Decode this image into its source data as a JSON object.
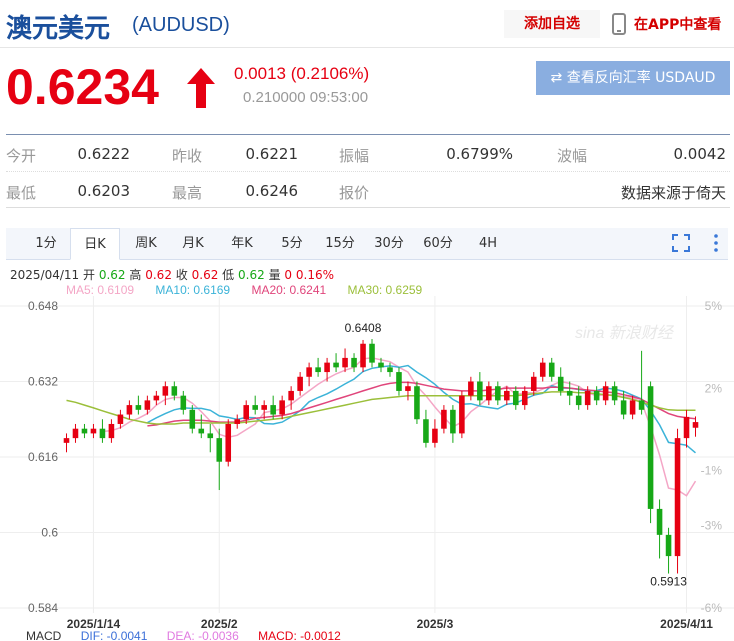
{
  "header": {
    "title": "澳元美元",
    "code": "(AUDUSD)",
    "add_favorite": "添加自选",
    "view_in_app": "在APP中查看"
  },
  "quote": {
    "price": "0.6234",
    "change": "0.0013 (0.2106%)",
    "subinfo": "0.210000 09:53:00",
    "reverse_button": "⇄ 查看反向汇率 USDAUD"
  },
  "stats": [
    [
      {
        "label": "今开",
        "value": "0.6222"
      },
      {
        "label": "昨收",
        "value": "0.6221"
      },
      {
        "label": "振幅",
        "value": "0.6799%"
      },
      {
        "label": "波幅",
        "value": "0.0042"
      }
    ],
    [
      {
        "label": "最低",
        "value": "0.6203"
      },
      {
        "label": "最高",
        "value": "0.6246"
      },
      {
        "label": "报价",
        "value": "数据来源于倚天"
      }
    ]
  ],
  "tabs": [
    "1分",
    "日K",
    "周K",
    "月K",
    "年K",
    "5分",
    "15分",
    "30分",
    "60分",
    "4H"
  ],
  "active_tab": "日K",
  "ohlc": {
    "date": "2025/04/11",
    "open_label": "开",
    "open": "0.62",
    "high_label": "高",
    "high": "0.62",
    "close_label": "收",
    "close": "0.62",
    "low_label": "低",
    "low": "0.62",
    "vol_label": "量",
    "vol": "0",
    "pct": "0.16%"
  },
  "ma_legend": [
    {
      "label": "MA5: 0.6109",
      "color": "#f4a6c6"
    },
    {
      "label": "MA10: 0.6169",
      "color": "#3bb3d8"
    },
    {
      "label": "MA20: 0.6241",
      "color": "#e0457b"
    },
    {
      "label": "MA30: 0.6259",
      "color": "#9bbf3a"
    }
  ],
  "macd": [
    {
      "label": "MACD",
      "color": "#333333"
    },
    {
      "label": "DIF: -0.0041",
      "color": "#3b6fd8"
    },
    {
      "label": "DEA: -0.0036",
      "color": "#e07ae0"
    },
    {
      "label": "MACD: -0.0012",
      "color": "#e60012"
    }
  ],
  "colors": {
    "up": "#e60012",
    "down": "#17a817",
    "title": "#1a4f9c"
  },
  "icons": {
    "arrow": "up-arrow-icon",
    "phone": "phone-icon",
    "fullscreen": "fullscreen-icon",
    "more": "more-vertical-icon"
  },
  "chart_data": {
    "type": "candlestick",
    "ylim": [
      0.584,
      0.648
    ],
    "y_ticks": [
      "0.648",
      "0.632",
      "0.616",
      "0.6",
      "0.584"
    ],
    "y_tick_values": [
      0.648,
      0.632,
      0.616,
      0.6,
      0.584
    ],
    "pct_ticks": [
      "5%",
      "2%",
      "-1%",
      "-3%",
      "-6%"
    ],
    "pct_tick_values": [
      5,
      2,
      -1,
      -3,
      -6
    ],
    "pct_lim": [
      5,
      -6
    ],
    "x_labels": [
      {
        "label": "2025/1/14",
        "index": 3
      },
      {
        "label": "2025/2",
        "index": 17
      },
      {
        "label": "2025/3",
        "index": 41
      },
      {
        "label": "2025/4/11",
        "index": 69
      }
    ],
    "annotations": [
      {
        "label": "0.6408",
        "index": 33,
        "value": 0.6408
      },
      {
        "label": "0.5913",
        "index": 67,
        "value": 0.5913
      }
    ],
    "candles": [
      {
        "o": 0.619,
        "h": 0.621,
        "l": 0.617,
        "c": 0.62
      },
      {
        "o": 0.62,
        "h": 0.623,
        "l": 0.619,
        "c": 0.622
      },
      {
        "o": 0.622,
        "h": 0.623,
        "l": 0.62,
        "c": 0.621
      },
      {
        "o": 0.621,
        "h": 0.623,
        "l": 0.62,
        "c": 0.622
      },
      {
        "o": 0.622,
        "h": 0.624,
        "l": 0.619,
        "c": 0.62
      },
      {
        "o": 0.62,
        "h": 0.624,
        "l": 0.619,
        "c": 0.623
      },
      {
        "o": 0.623,
        "h": 0.626,
        "l": 0.622,
        "c": 0.625
      },
      {
        "o": 0.625,
        "h": 0.628,
        "l": 0.624,
        "c": 0.627
      },
      {
        "o": 0.627,
        "h": 0.629,
        "l": 0.625,
        "c": 0.626
      },
      {
        "o": 0.626,
        "h": 0.629,
        "l": 0.625,
        "c": 0.628
      },
      {
        "o": 0.628,
        "h": 0.63,
        "l": 0.627,
        "c": 0.629
      },
      {
        "o": 0.629,
        "h": 0.632,
        "l": 0.627,
        "c": 0.631
      },
      {
        "o": 0.631,
        "h": 0.632,
        "l": 0.628,
        "c": 0.629
      },
      {
        "o": 0.629,
        "h": 0.63,
        "l": 0.625,
        "c": 0.626
      },
      {
        "o": 0.626,
        "h": 0.627,
        "l": 0.621,
        "c": 0.622
      },
      {
        "o": 0.622,
        "h": 0.625,
        "l": 0.62,
        "c": 0.621
      },
      {
        "o": 0.621,
        "h": 0.623,
        "l": 0.617,
        "c": 0.62
      },
      {
        "o": 0.62,
        "h": 0.622,
        "l": 0.609,
        "c": 0.615
      },
      {
        "o": 0.615,
        "h": 0.624,
        "l": 0.614,
        "c": 0.623
      },
      {
        "o": 0.623,
        "h": 0.625,
        "l": 0.622,
        "c": 0.624
      },
      {
        "o": 0.624,
        "h": 0.628,
        "l": 0.623,
        "c": 0.627
      },
      {
        "o": 0.627,
        "h": 0.629,
        "l": 0.625,
        "c": 0.626
      },
      {
        "o": 0.626,
        "h": 0.628,
        "l": 0.624,
        "c": 0.627
      },
      {
        "o": 0.627,
        "h": 0.629,
        "l": 0.624,
        "c": 0.625
      },
      {
        "o": 0.625,
        "h": 0.629,
        "l": 0.624,
        "c": 0.628
      },
      {
        "o": 0.628,
        "h": 0.631,
        "l": 0.626,
        "c": 0.63
      },
      {
        "o": 0.63,
        "h": 0.634,
        "l": 0.629,
        "c": 0.633
      },
      {
        "o": 0.633,
        "h": 0.636,
        "l": 0.631,
        "c": 0.635
      },
      {
        "o": 0.635,
        "h": 0.637,
        "l": 0.633,
        "c": 0.634
      },
      {
        "o": 0.634,
        "h": 0.637,
        "l": 0.632,
        "c": 0.636
      },
      {
        "o": 0.636,
        "h": 0.638,
        "l": 0.634,
        "c": 0.635
      },
      {
        "o": 0.635,
        "h": 0.639,
        "l": 0.634,
        "c": 0.637
      },
      {
        "o": 0.637,
        "h": 0.638,
        "l": 0.634,
        "c": 0.635
      },
      {
        "o": 0.635,
        "h": 0.6408,
        "l": 0.634,
        "c": 0.64
      },
      {
        "o": 0.64,
        "h": 0.641,
        "l": 0.635,
        "c": 0.636
      },
      {
        "o": 0.636,
        "h": 0.637,
        "l": 0.634,
        "c": 0.635
      },
      {
        "o": 0.635,
        "h": 0.636,
        "l": 0.633,
        "c": 0.634
      },
      {
        "o": 0.634,
        "h": 0.635,
        "l": 0.629,
        "c": 0.63
      },
      {
        "o": 0.63,
        "h": 0.632,
        "l": 0.628,
        "c": 0.631
      },
      {
        "o": 0.631,
        "h": 0.632,
        "l": 0.623,
        "c": 0.624
      },
      {
        "o": 0.624,
        "h": 0.626,
        "l": 0.618,
        "c": 0.619
      },
      {
        "o": 0.619,
        "h": 0.624,
        "l": 0.618,
        "c": 0.622
      },
      {
        "o": 0.622,
        "h": 0.627,
        "l": 0.621,
        "c": 0.626
      },
      {
        "o": 0.626,
        "h": 0.627,
        "l": 0.619,
        "c": 0.621
      },
      {
        "o": 0.621,
        "h": 0.63,
        "l": 0.62,
        "c": 0.629
      },
      {
        "o": 0.629,
        "h": 0.633,
        "l": 0.628,
        "c": 0.632
      },
      {
        "o": 0.632,
        "h": 0.634,
        "l": 0.627,
        "c": 0.628
      },
      {
        "o": 0.628,
        "h": 0.632,
        "l": 0.627,
        "c": 0.631
      },
      {
        "o": 0.631,
        "h": 0.632,
        "l": 0.627,
        "c": 0.628
      },
      {
        "o": 0.628,
        "h": 0.631,
        "l": 0.627,
        "c": 0.63
      },
      {
        "o": 0.63,
        "h": 0.631,
        "l": 0.626,
        "c": 0.627
      },
      {
        "o": 0.627,
        "h": 0.631,
        "l": 0.626,
        "c": 0.63
      },
      {
        "o": 0.63,
        "h": 0.634,
        "l": 0.629,
        "c": 0.633
      },
      {
        "o": 0.633,
        "h": 0.637,
        "l": 0.632,
        "c": 0.636
      },
      {
        "o": 0.636,
        "h": 0.637,
        "l": 0.632,
        "c": 0.633
      },
      {
        "o": 0.633,
        "h": 0.635,
        "l": 0.629,
        "c": 0.63
      },
      {
        "o": 0.63,
        "h": 0.632,
        "l": 0.627,
        "c": 0.629
      },
      {
        "o": 0.629,
        "h": 0.631,
        "l": 0.626,
        "c": 0.627
      },
      {
        "o": 0.627,
        "h": 0.631,
        "l": 0.626,
        "c": 0.63
      },
      {
        "o": 0.63,
        "h": 0.631,
        "l": 0.627,
        "c": 0.628
      },
      {
        "o": 0.628,
        "h": 0.632,
        "l": 0.627,
        "c": 0.631
      },
      {
        "o": 0.631,
        "h": 0.632,
        "l": 0.627,
        "c": 0.628
      },
      {
        "o": 0.628,
        "h": 0.63,
        "l": 0.624,
        "c": 0.625
      },
      {
        "o": 0.625,
        "h": 0.629,
        "l": 0.624,
        "c": 0.628
      },
      {
        "o": 0.628,
        "h": 0.6385,
        "l": 0.625,
        "c": 0.626
      },
      {
        "o": 0.631,
        "h": 0.632,
        "l": 0.602,
        "c": 0.605
      },
      {
        "o": 0.605,
        "h": 0.607,
        "l": 0.5945,
        "c": 0.5995
      },
      {
        "o": 0.5995,
        "h": 0.601,
        "l": 0.5913,
        "c": 0.595
      },
      {
        "o": 0.595,
        "h": 0.622,
        "l": 0.5913,
        "c": 0.62
      },
      {
        "o": 0.62,
        "h": 0.626,
        "l": 0.618,
        "c": 0.6245
      },
      {
        "o": 0.6222,
        "h": 0.6246,
        "l": 0.6203,
        "c": 0.6234
      }
    ],
    "ma_series": [
      {
        "name": "MA5",
        "color": "#f4a6c6",
        "values": [
          null,
          null,
          null,
          null,
          0.6214,
          0.6216,
          0.6222,
          0.6234,
          0.6242,
          0.6252,
          0.627,
          0.6282,
          0.6286,
          0.6286,
          0.6274,
          0.6256,
          0.6236,
          0.6208,
          0.6202,
          0.6206,
          0.6218,
          0.623,
          0.6254,
          0.6258,
          0.6262,
          0.6272,
          0.6286,
          0.63,
          0.6314,
          0.6326,
          0.6336,
          0.6344,
          0.635,
          0.6368,
          0.637,
          0.6366,
          0.6362,
          0.635,
          0.634,
          0.631,
          0.629,
          0.6266,
          0.6244,
          0.6224,
          0.6234,
          0.6256,
          0.627,
          0.6286,
          0.63,
          0.631,
          0.6292,
          0.6296,
          0.6296,
          0.6304,
          0.6312,
          0.632,
          0.6316,
          0.631,
          0.6296,
          0.629,
          0.6292,
          0.6292,
          0.6288,
          0.6286,
          0.6276,
          0.6224,
          0.6164,
          0.6094,
          0.609,
          0.6078,
          0.6109
        ]
      },
      {
        "name": "MA10",
        "color": "#3bb3d8",
        "values": [
          null,
          null,
          null,
          null,
          null,
          null,
          null,
          null,
          null,
          0.6233,
          0.6243,
          0.6252,
          0.626,
          0.6264,
          0.6263,
          0.6263,
          0.6259,
          0.6247,
          0.6244,
          0.624,
          0.6244,
          0.6243,
          0.6231,
          0.623,
          0.6234,
          0.6245,
          0.6258,
          0.6277,
          0.6286,
          0.6294,
          0.6304,
          0.6315,
          0.6325,
          0.6341,
          0.6348,
          0.6351,
          0.6353,
          0.635,
          0.6354,
          0.634,
          0.6328,
          0.6314,
          0.6297,
          0.6282,
          0.6272,
          0.6273,
          0.6268,
          0.6265,
          0.6262,
          0.6272,
          0.6274,
          0.6283,
          0.6291,
          0.6295,
          0.6311,
          0.6306,
          0.6306,
          0.6303,
          0.63,
          0.6301,
          0.6306,
          0.6304,
          0.6299,
          0.6291,
          0.6283,
          0.6258,
          0.6228,
          0.6191,
          0.6188,
          0.6185,
          0.6169
        ]
      },
      {
        "name": "MA20",
        "color": "#e0457b",
        "values": [
          null,
          null,
          null,
          null,
          null,
          null,
          null,
          null,
          null,
          0.6226,
          0.6228,
          0.6232,
          0.6236,
          0.6238,
          0.6238,
          0.6238,
          0.6236,
          0.6234,
          0.6234,
          0.6234,
          0.6238,
          0.6242,
          0.6244,
          0.6246,
          0.6248,
          0.6252,
          0.6258,
          0.6264,
          0.627,
          0.6276,
          0.6282,
          0.6288,
          0.6294,
          0.63,
          0.6306,
          0.6312,
          0.6316,
          0.6318,
          0.6318,
          0.6316,
          0.6312,
          0.6308,
          0.6304,
          0.6302,
          0.63,
          0.63,
          0.63,
          0.6302,
          0.6304,
          0.6306,
          0.6306,
          0.6306,
          0.6306,
          0.6306,
          0.6308,
          0.6308,
          0.6306,
          0.6304,
          0.6302,
          0.63,
          0.6298,
          0.6296,
          0.6292,
          0.6288,
          0.6282,
          0.6272,
          0.6262,
          0.6252,
          0.6246,
          0.6243,
          0.6241
        ]
      },
      {
        "name": "MA30",
        "color": "#9bbf3a",
        "values": [
          0.628,
          0.6276,
          0.627,
          0.6264,
          0.6258,
          0.6252,
          0.6246,
          0.624,
          0.6236,
          0.6232,
          0.623,
          0.623,
          0.623,
          0.6232,
          0.6232,
          0.6232,
          0.6232,
          0.6232,
          0.6232,
          0.6232,
          0.6234,
          0.6236,
          0.6238,
          0.624,
          0.6242,
          0.6246,
          0.625,
          0.6254,
          0.6258,
          0.6262,
          0.6266,
          0.627,
          0.6274,
          0.6278,
          0.6282,
          0.6284,
          0.6286,
          0.6288,
          0.629,
          0.629,
          0.629,
          0.629,
          0.629,
          0.629,
          0.629,
          0.629,
          0.629,
          0.629,
          0.629,
          0.629,
          0.629,
          0.6292,
          0.6294,
          0.6296,
          0.6298,
          0.6298,
          0.6298,
          0.6296,
          0.6296,
          0.6294,
          0.6292,
          0.629,
          0.6286,
          0.6282,
          0.6276,
          0.627,
          0.6264,
          0.626,
          0.6259,
          0.6259,
          0.6259
        ]
      }
    ]
  }
}
